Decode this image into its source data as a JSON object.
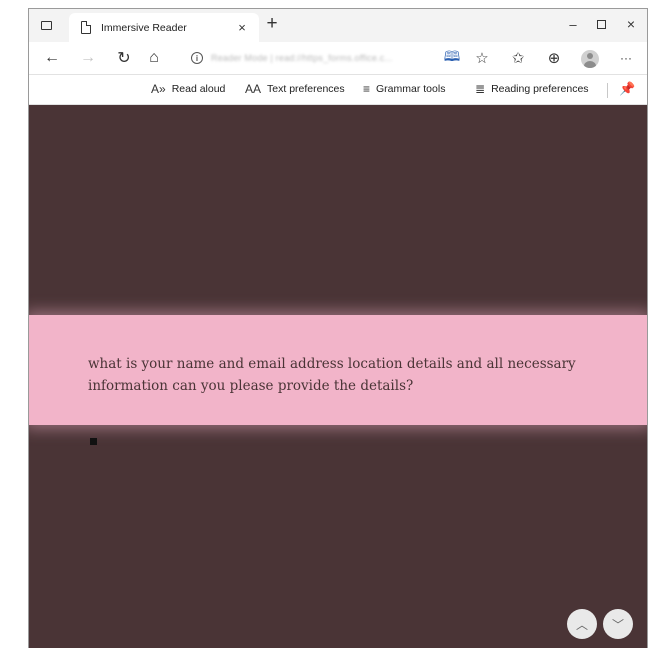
{
  "tab": {
    "title": "Immersive Reader",
    "close": "×",
    "new_tab": "+"
  },
  "window": {
    "minimize": "–",
    "close": "×"
  },
  "address": {
    "text": "Reader Mode  |  read://https_forms.office.c..."
  },
  "toolbar": {
    "read_aloud": "Read aloud",
    "text_preferences": "Text preferences",
    "grammar_tools": "Grammar tools",
    "reading_preferences": "Reading preferences"
  },
  "icons": {
    "back": "←",
    "forward": "→",
    "refresh": "↻",
    "home": "⌂",
    "info": "i",
    "reader": "🕮",
    "favorite_add": "☆",
    "favorites": "✩",
    "collections": "⊕",
    "more": "···",
    "read_aloud": "A»",
    "text_prefs": "AA",
    "grammar": "≡",
    "reading_prefs": "≣",
    "pin": "📌",
    "scroll_up": "︿",
    "scroll_down": "﹀"
  },
  "reader": {
    "highlighted_text": "what is your name and email address location details and all necessary information can you please provide the details?"
  },
  "colors": {
    "reader_background": "#4a3436",
    "line_focus": "#f2b4c9",
    "text": "#4a3436"
  }
}
